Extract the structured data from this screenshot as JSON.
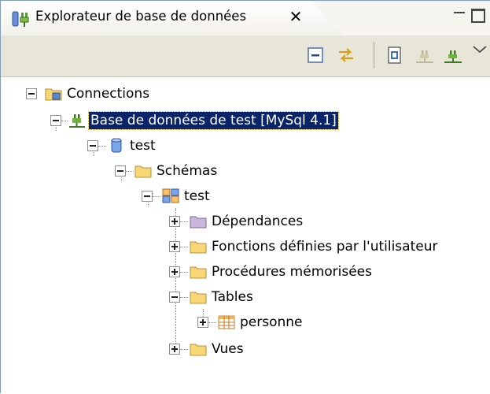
{
  "view": {
    "title": "Explorateur de base de données",
    "close_glyph": "✕"
  },
  "toolbar": {
    "buttons": [
      {
        "icon": "collapse-all-icon"
      },
      {
        "icon": "link-with-editor-icon"
      },
      {
        "icon": "new-sql-file-icon"
      },
      {
        "icon": "disconnect-icon"
      },
      {
        "icon": "connect-icon"
      },
      {
        "icon": "view-menu-icon"
      }
    ]
  },
  "tree": {
    "root": "Connections",
    "connection": "Base de données de test [MySql 4.1]",
    "database": "test",
    "schemas_folder": "Schémas",
    "schema": "test",
    "folders": {
      "dependencies": "Dépendances",
      "udf": "Fonctions définies par l'utilisateur",
      "stored_procedures": "Procédures mémorisées",
      "tables": "Tables",
      "views": "Vues"
    },
    "table": "personne"
  },
  "colors": {
    "selection": "#0a246a",
    "folder": "#f8d775",
    "folder_special": "#c8b7d9"
  }
}
